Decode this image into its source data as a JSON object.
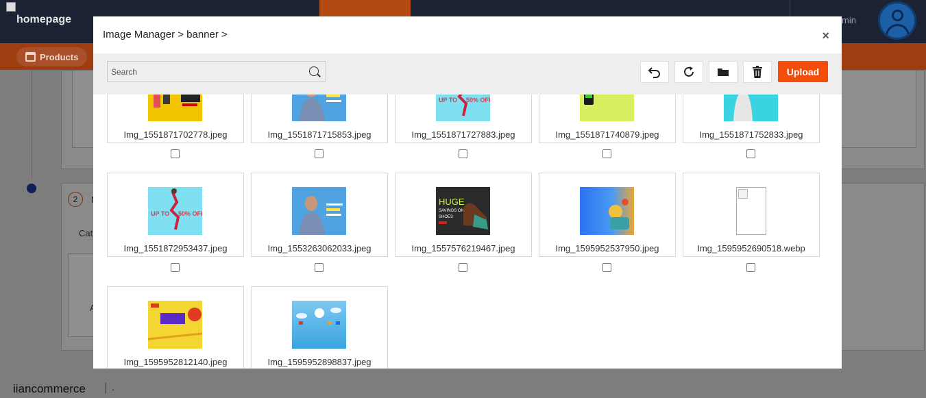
{
  "app": {
    "brand": "homepage",
    "admin_label": "min",
    "subnav_label": "Products",
    "footer_brand": "iiancommerce",
    "footer_dot": ".",
    "step_number": "2",
    "bg_cat": "Cat",
    "bg_a": "A",
    "bg_m": "N"
  },
  "modal": {
    "title": "Image Manager > banner >",
    "close_label": "×",
    "search_placeholder": "Search",
    "upload_label": "Upload",
    "toolbar_icons": [
      "undo-icon",
      "refresh-icon",
      "folder-icon",
      "trash-icon"
    ]
  },
  "images": [
    {
      "name": "Img_1551871702778.jpeg",
      "thumb": "yellow"
    },
    {
      "name": "Img_1551871715853.jpeg",
      "thumb": "blue"
    },
    {
      "name": "Img_1551871727883.jpeg",
      "thumb": "cyan"
    },
    {
      "name": "Img_1551871740879.jpeg",
      "thumb": "green"
    },
    {
      "name": "Img_1551871752833.jpeg",
      "thumb": "cyan2"
    },
    {
      "name": "Img_1551872953437.jpeg",
      "thumb": "cyan"
    },
    {
      "name": "Img_1553263062033.jpeg",
      "thumb": "blue"
    },
    {
      "name": "Img_1557576219467.jpeg",
      "thumb": "dark"
    },
    {
      "name": "Img_1595952537950.jpeg",
      "thumb": "grad"
    },
    {
      "name": "Img_1595952690518.webp",
      "thumb": "broken"
    },
    {
      "name": "Img_1595952812140.jpeg",
      "thumb": "yel2"
    },
    {
      "name": "Img_1595952898837.jpeg",
      "thumb": "sky"
    }
  ],
  "thumb_text": {
    "upto": "UP TO",
    "off": "50% OFF",
    "huge": "HUGE",
    "savings": "SAVINGS ON",
    "shoes": "SHOES"
  }
}
